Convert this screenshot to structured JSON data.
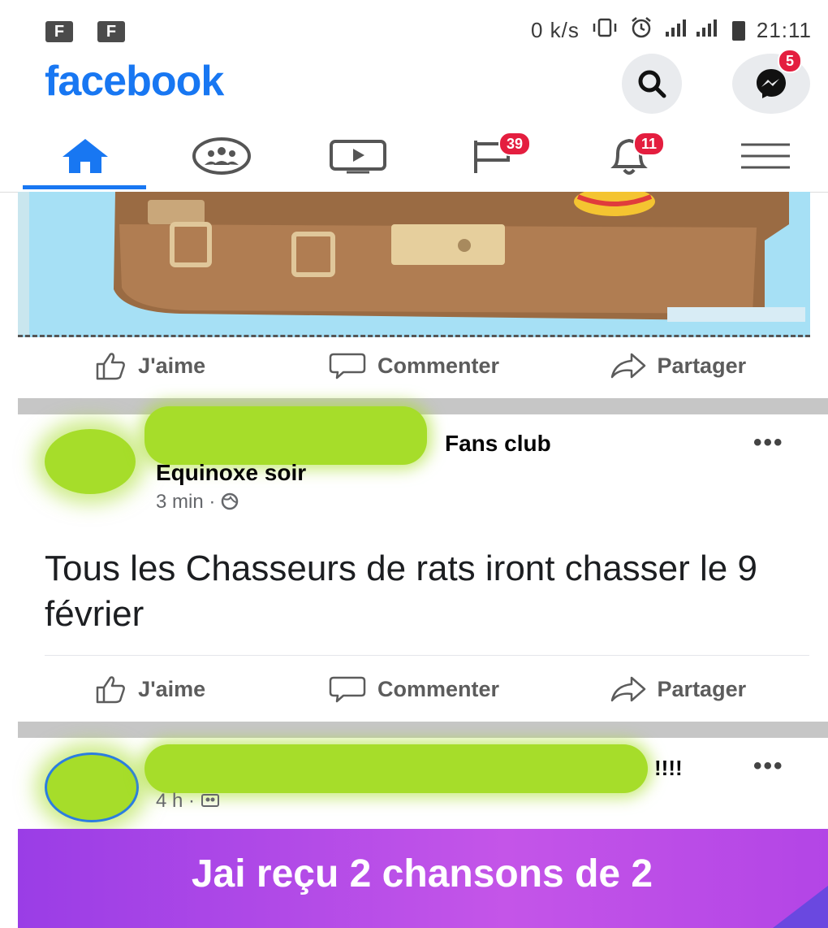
{
  "status_bar": {
    "notif_icon_1": "F",
    "notif_icon_2": "F",
    "net_speed": "0 k/s",
    "time": "21:11"
  },
  "header": {
    "brand": "facebook",
    "messenger_badge": "5"
  },
  "tabs": {
    "groups_badge": "39",
    "notifications_badge": "11"
  },
  "actions": {
    "like": "J'aime",
    "comment": "Commenter",
    "share": "Partager"
  },
  "post1": {
    "group": "Fans club",
    "author": "Equinoxe soir",
    "time": "3 min",
    "body": "Tous les Chasseurs de rats iront chasser le 9 février"
  },
  "post2": {
    "title_suffix": "!!!!",
    "time": "4 h",
    "banner_text": "Jai reçu 2 chansons de 2"
  },
  "colors": {
    "brand": "#1877f2",
    "badge": "#e41e3f",
    "redaction": "#a6dd2a",
    "banner": "#b345e6"
  }
}
